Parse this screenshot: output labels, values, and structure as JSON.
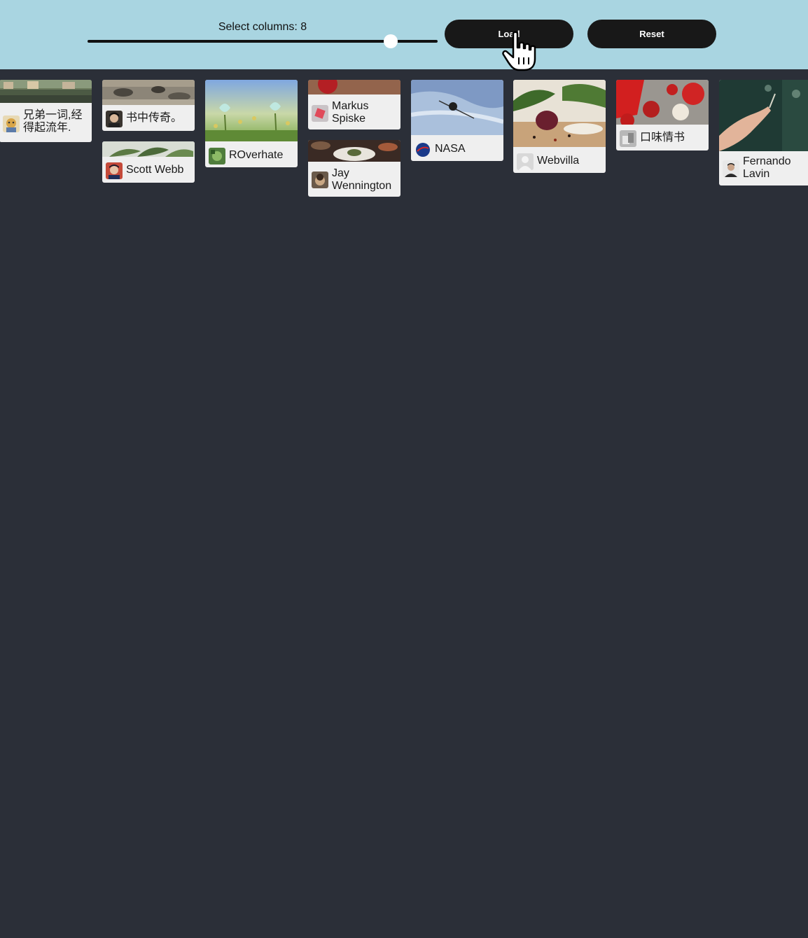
{
  "controls": {
    "label_prefix": "Select columns: ",
    "columns": 8,
    "columns_min": 1,
    "columns_max": 10,
    "load_label": "Load",
    "reset_label": "Reset"
  },
  "cards": [
    {
      "name": "兄弟一词,经得起流年.",
      "photo": "lakeside-houses"
    },
    {
      "name": "书中传奇。",
      "photo": "rocky-shore"
    },
    {
      "name": "Scott Webb",
      "photo": "green-leaves"
    },
    {
      "name": "ROverhate",
      "photo": "butterflies-flowers"
    },
    {
      "name": "Markus Spiske",
      "photo": "red-apple"
    },
    {
      "name": "Jay Wennington",
      "photo": "plated-dish"
    },
    {
      "name": "NASA",
      "photo": "satellite-earth"
    },
    {
      "name": "Webvilla",
      "photo": "onions-herbs"
    },
    {
      "name": "口味情书",
      "photo": "tomatoes-garlic"
    },
    {
      "name": "Fernando Lavin",
      "photo": "hand-reaching"
    }
  ]
}
